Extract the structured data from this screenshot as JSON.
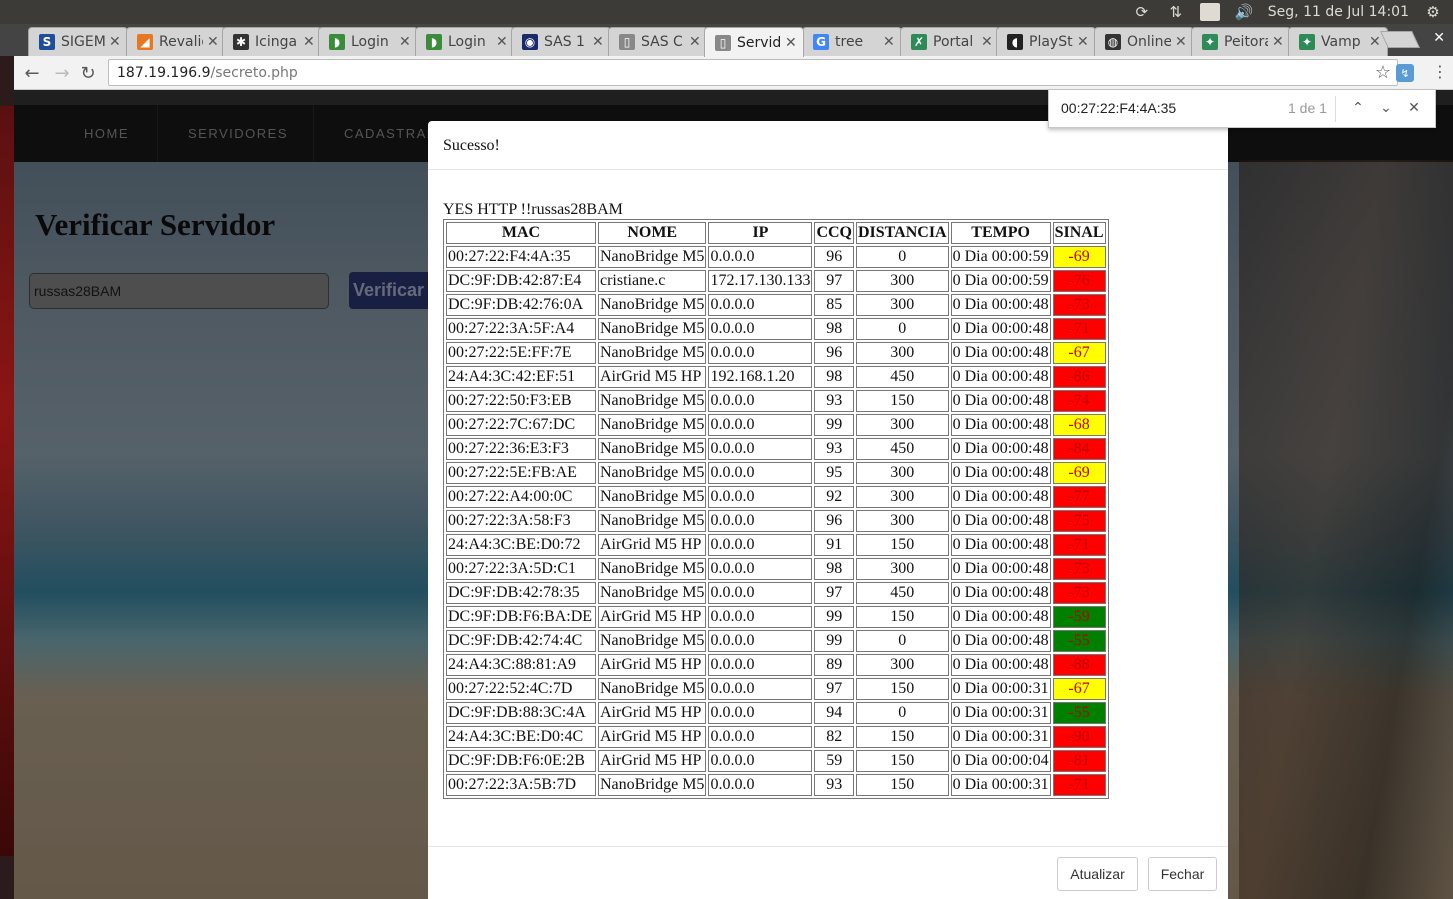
{
  "os": {
    "datetime": "Seg, 11 de Jul 14:01",
    "lang": "Pt"
  },
  "tabs": [
    {
      "title": "SIGEM",
      "favicon_color": "#1e4e9a",
      "favicon_glyph": "S",
      "active": false
    },
    {
      "title": "Revalidar",
      "favicon_color": "#e87722",
      "favicon_glyph": "◢",
      "active": false
    },
    {
      "title": "Icinga",
      "favicon_color": "#333333",
      "favicon_glyph": "✱",
      "active": false
    },
    {
      "title": "Login",
      "favicon_color": "#3a8c3a",
      "favicon_glyph": "◗",
      "active": false
    },
    {
      "title": "Login",
      "favicon_color": "#3a8c3a",
      "favicon_glyph": "◗",
      "active": false
    },
    {
      "title": "SAS 1",
      "favicon_color": "#1a2a6a",
      "favicon_glyph": "◉",
      "active": false
    },
    {
      "title": "SAS C",
      "favicon_color": "#888888",
      "favicon_glyph": "▯",
      "active": false
    },
    {
      "title": "Servidores",
      "favicon_color": "#888888",
      "favicon_glyph": "▯",
      "active": true
    },
    {
      "title": "tree",
      "favicon_color": "#4285f4",
      "favicon_glyph": "G",
      "active": false
    },
    {
      "title": "Portal",
      "favicon_color": "#2e8b57",
      "favicon_glyph": "✗",
      "active": false
    },
    {
      "title": "PlayStation",
      "favicon_color": "#222222",
      "favicon_glyph": "◖",
      "active": false
    },
    {
      "title": "Online",
      "favicon_color": "#333333",
      "favicon_glyph": "◍",
      "active": false
    },
    {
      "title": "Peitoral",
      "favicon_color": "#2e8b57",
      "favicon_glyph": "✦",
      "active": false
    },
    {
      "title": "Vamp",
      "favicon_color": "#2e8b57",
      "favicon_glyph": "✦",
      "active": false
    }
  ],
  "address": {
    "host": "187.19.196.9",
    "path": "/secreto.php"
  },
  "site": {
    "nav": [
      "HOME",
      "SERVIDORES",
      "CADASTRAR"
    ],
    "title": "Verificar Servidor",
    "input_value": "russas28BAM",
    "verify_label": "Verificar"
  },
  "findbar": {
    "query": "00:27:22:F4:4A:35",
    "count": "1 de 1"
  },
  "modal": {
    "title": "Sucesso!",
    "status": "YES HTTP !!russas28BAM",
    "columns": [
      "MAC",
      "NOME",
      "IP",
      "CCQ",
      "DISTANCIA",
      "TEMPO",
      "SINAL"
    ],
    "signal_colors": {
      "yellow": "#ffff00",
      "red": "#ff0000",
      "green": "#008000"
    },
    "rows": [
      {
        "mac": "00:27:22:F4:4A:35",
        "nome": "NanoBridge M5",
        "ip": "0.0.0.0",
        "ccq": "96",
        "dist": "0",
        "tempo": "0 Dia 00:00:59",
        "sinal": "-69",
        "level": "yellow"
      },
      {
        "mac": "DC:9F:DB:42:87:E4",
        "nome": "cristiane.c",
        "ip": "172.17.130.133",
        "ccq": "97",
        "dist": "300",
        "tempo": "0 Dia 00:00:59",
        "sinal": "-76",
        "level": "red"
      },
      {
        "mac": "DC:9F:DB:42:76:0A",
        "nome": "NanoBridge M5",
        "ip": "0.0.0.0",
        "ccq": "85",
        "dist": "300",
        "tempo": "0 Dia 00:00:48",
        "sinal": "-73",
        "level": "red"
      },
      {
        "mac": "00:27:22:3A:5F:A4",
        "nome": "NanoBridge M5",
        "ip": "0.0.0.0",
        "ccq": "98",
        "dist": "0",
        "tempo": "0 Dia 00:00:48",
        "sinal": "-71",
        "level": "red"
      },
      {
        "mac": "00:27:22:5E:FF:7E",
        "nome": "NanoBridge M5",
        "ip": "0.0.0.0",
        "ccq": "96",
        "dist": "300",
        "tempo": "0 Dia 00:00:48",
        "sinal": "-67",
        "level": "yellow"
      },
      {
        "mac": "24:A4:3C:42:EF:51",
        "nome": "AirGrid M5 HP",
        "ip": "192.168.1.20",
        "ccq": "98",
        "dist": "450",
        "tempo": "0 Dia 00:00:48",
        "sinal": "-86",
        "level": "red"
      },
      {
        "mac": "00:27:22:50:F3:EB",
        "nome": "NanoBridge M5",
        "ip": "0.0.0.0",
        "ccq": "93",
        "dist": "150",
        "tempo": "0 Dia 00:00:48",
        "sinal": "-74",
        "level": "red"
      },
      {
        "mac": "00:27:22:7C:67:DC",
        "nome": "NanoBridge M5",
        "ip": "0.0.0.0",
        "ccq": "99",
        "dist": "300",
        "tempo": "0 Dia 00:00:48",
        "sinal": "-68",
        "level": "yellow"
      },
      {
        "mac": "00:27:22:36:E3:F3",
        "nome": "NanoBridge M5",
        "ip": "0.0.0.0",
        "ccq": "93",
        "dist": "450",
        "tempo": "0 Dia 00:00:48",
        "sinal": "-84",
        "level": "red"
      },
      {
        "mac": "00:27:22:5E:FB:AE",
        "nome": "NanoBridge M5",
        "ip": "0.0.0.0",
        "ccq": "95",
        "dist": "300",
        "tempo": "0 Dia 00:00:48",
        "sinal": "-69",
        "level": "yellow"
      },
      {
        "mac": "00:27:22:A4:00:0C",
        "nome": "NanoBridge M5",
        "ip": "0.0.0.0",
        "ccq": "92",
        "dist": "300",
        "tempo": "0 Dia 00:00:48",
        "sinal": "-77",
        "level": "red"
      },
      {
        "mac": "00:27:22:3A:58:F3",
        "nome": "NanoBridge M5",
        "ip": "0.0.0.0",
        "ccq": "96",
        "dist": "300",
        "tempo": "0 Dia 00:00:48",
        "sinal": "-75",
        "level": "red"
      },
      {
        "mac": "24:A4:3C:BE:D0:72",
        "nome": "AirGrid M5 HP",
        "ip": "0.0.0.0",
        "ccq": "91",
        "dist": "150",
        "tempo": "0 Dia 00:00:48",
        "sinal": "-71",
        "level": "red"
      },
      {
        "mac": "00:27:22:3A:5D:C1",
        "nome": "NanoBridge M5",
        "ip": "0.0.0.0",
        "ccq": "98",
        "dist": "300",
        "tempo": "0 Dia 00:00:48",
        "sinal": "-73",
        "level": "red"
      },
      {
        "mac": "DC:9F:DB:42:78:35",
        "nome": "NanoBridge M5",
        "ip": "0.0.0.0",
        "ccq": "97",
        "dist": "450",
        "tempo": "0 Dia 00:00:48",
        "sinal": "-73",
        "level": "red"
      },
      {
        "mac": "DC:9F:DB:F6:BA:DE",
        "nome": "AirGrid M5 HP",
        "ip": "0.0.0.0",
        "ccq": "99",
        "dist": "150",
        "tempo": "0 Dia 00:00:48",
        "sinal": "-59",
        "level": "green"
      },
      {
        "mac": "DC:9F:DB:42:74:4C",
        "nome": "NanoBridge M5",
        "ip": "0.0.0.0",
        "ccq": "99",
        "dist": "0",
        "tempo": "0 Dia 00:00:48",
        "sinal": "-55",
        "level": "green"
      },
      {
        "mac": "24:A4:3C:88:81:A9",
        "nome": "AirGrid M5 HP",
        "ip": "0.0.0.0",
        "ccq": "89",
        "dist": "300",
        "tempo": "0 Dia 00:00:48",
        "sinal": "-88",
        "level": "red"
      },
      {
        "mac": "00:27:22:52:4C:7D",
        "nome": "NanoBridge M5",
        "ip": "0.0.0.0",
        "ccq": "97",
        "dist": "150",
        "tempo": "0 Dia 00:00:31",
        "sinal": "-67",
        "level": "yellow"
      },
      {
        "mac": "DC:9F:DB:88:3C:4A",
        "nome": "AirGrid M5 HP",
        "ip": "0.0.0.0",
        "ccq": "94",
        "dist": "0",
        "tempo": "0 Dia 00:00:31",
        "sinal": "-55",
        "level": "green"
      },
      {
        "mac": "24:A4:3C:BE:D0:4C",
        "nome": "AirGrid M5 HP",
        "ip": "0.0.0.0",
        "ccq": "82",
        "dist": "150",
        "tempo": "0 Dia 00:00:31",
        "sinal": "-90",
        "level": "red"
      },
      {
        "mac": "DC:9F:DB:F6:0E:2B",
        "nome": "AirGrid M5 HP",
        "ip": "0.0.0.0",
        "ccq": "59",
        "dist": "150",
        "tempo": "0 Dia 00:00:04",
        "sinal": "-81",
        "level": "red"
      },
      {
        "mac": "00:27:22:3A:5B:7D",
        "nome": "NanoBridge M5",
        "ip": "0.0.0.0",
        "ccq": "93",
        "dist": "150",
        "tempo": "0 Dia 00:00:31",
        "sinal": "-71",
        "level": "red"
      }
    ],
    "buttons": {
      "refresh": "Atualizar",
      "close": "Fechar"
    }
  }
}
